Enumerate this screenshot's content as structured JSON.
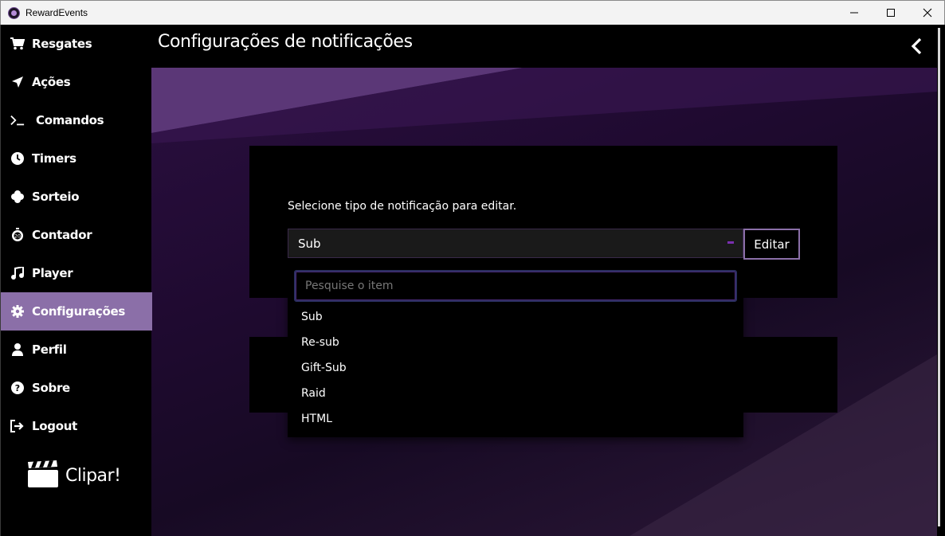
{
  "window": {
    "title": "RewardEvents",
    "minimize_icon": "minimize-icon",
    "maximize_icon": "maximize-icon",
    "close_icon": "close-icon"
  },
  "sidebar": {
    "items": [
      {
        "label": "Resgates",
        "icon": "cart-icon"
      },
      {
        "label": "Ações",
        "icon": "location-arrow-icon"
      },
      {
        "label": "Comandos",
        "icon": "terminal-icon"
      },
      {
        "label": "Timers",
        "icon": "clock-icon"
      },
      {
        "label": "Sorteio",
        "icon": "clover-icon"
      },
      {
        "label": "Contador",
        "icon": "stopwatch-icon"
      },
      {
        "label": "Player",
        "icon": "music-note-icon"
      },
      {
        "label": "Configurações",
        "icon": "gear-icon"
      },
      {
        "label": "Perfil",
        "icon": "user-icon"
      },
      {
        "label": "Sobre",
        "icon": "question-circle-icon"
      },
      {
        "label": "Logout",
        "icon": "logout-icon"
      }
    ],
    "active": "Configurações",
    "clipar": {
      "label": "Clipar!",
      "icon": "clapperboard-icon"
    }
  },
  "header": {
    "title": "Configurações de notificações",
    "back_icon": "chevron-left-icon"
  },
  "main": {
    "select_label": "Selecione tipo de notificação para editar.",
    "select_value": "Sub",
    "edit_button": "Editar",
    "dropdown": {
      "search_placeholder": "Pesquise o item",
      "options": [
        "Sub",
        "Re-sub",
        "Gift-Sub",
        "Raid",
        "HTML"
      ]
    }
  },
  "colors": {
    "accent": "#8b6fa8",
    "background_purple": "#2a0f3f",
    "caret": "#7a2fb0"
  }
}
